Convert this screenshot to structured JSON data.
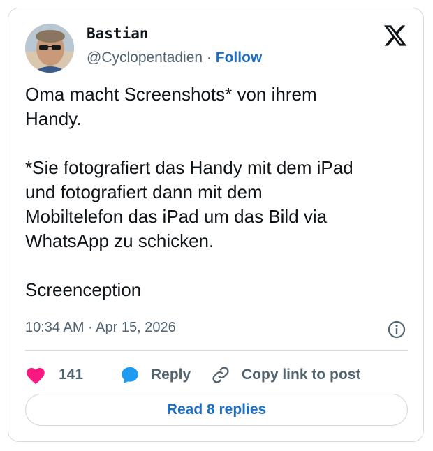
{
  "author": {
    "name": "Bastian",
    "handle": "@Cyclopentadien",
    "separator": " · ",
    "follow_label": "Follow"
  },
  "post": {
    "text": "Oma macht Screenshots* von ihrem\nHandy.\n\n*Sie fotografiert das Handy mit dem iPad\nund fotografiert dann mit dem\nMobiltelefon das iPad um das Bild via\nWhatsApp zu schicken.\n\nScreenception",
    "timestamp": "10:34 AM · Apr 15, 2026"
  },
  "actions": {
    "likes": "141",
    "reply_label": "Reply",
    "copy_link_label": "Copy link to post"
  },
  "replies_button": "Read 8 replies",
  "colors": {
    "accent": "#1d6fc4",
    "like": "#f91880",
    "muted": "#536471"
  },
  "icons": [
    "x-logo-icon",
    "info-icon",
    "heart-icon",
    "reply-bubble-icon",
    "link-icon"
  ]
}
